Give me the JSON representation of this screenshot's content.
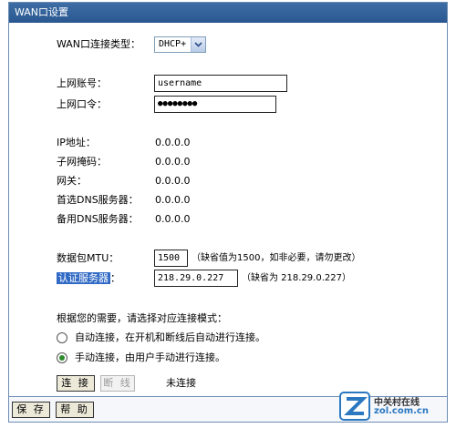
{
  "window": {
    "title": "WAN口设置"
  },
  "wan_type": {
    "label": "WAN口连接类型：",
    "selected": "DHCP+"
  },
  "account": {
    "label": "上网账号：",
    "value": "username"
  },
  "password": {
    "label": "上网口令：",
    "value": "●●●●●●●●"
  },
  "status": [
    {
      "label": "IP地址：",
      "value": "0.0.0.0"
    },
    {
      "label": "子网掩码：",
      "value": "0.0.0.0"
    },
    {
      "label": "网关：",
      "value": "0.0.0.0"
    },
    {
      "label": "首选DNS服务器：",
      "value": "0.0.0.0"
    },
    {
      "label": "备用DNS服务器：",
      "value": "0.0.0.0"
    }
  ],
  "mtu": {
    "label": "数据包MTU：",
    "value": "1500",
    "hint": "（缺省值为1500，如非必要，请勿更改）"
  },
  "auth_server": {
    "label": "认证服务器",
    "colon": "：",
    "value": "218.29.0.227",
    "hint": "（缺省为 218.29.0.227）"
  },
  "mode": {
    "prompt": "根据您的需要，请选择对应连接模式：",
    "options": [
      {
        "label": "自动连接，在开机和断线后自动进行连接。",
        "selected": false
      },
      {
        "label": "手动连接，由用户手动进行连接。",
        "selected": true
      }
    ]
  },
  "actions": {
    "connect": "连 接",
    "disconnect": "断 线",
    "status": "未连接"
  },
  "footer": {
    "save": "保 存",
    "help": "帮 助"
  },
  "watermark": {
    "line1": "中关村在线",
    "line2": "zol.com.cn",
    "accent_color": "#2b77c0"
  }
}
